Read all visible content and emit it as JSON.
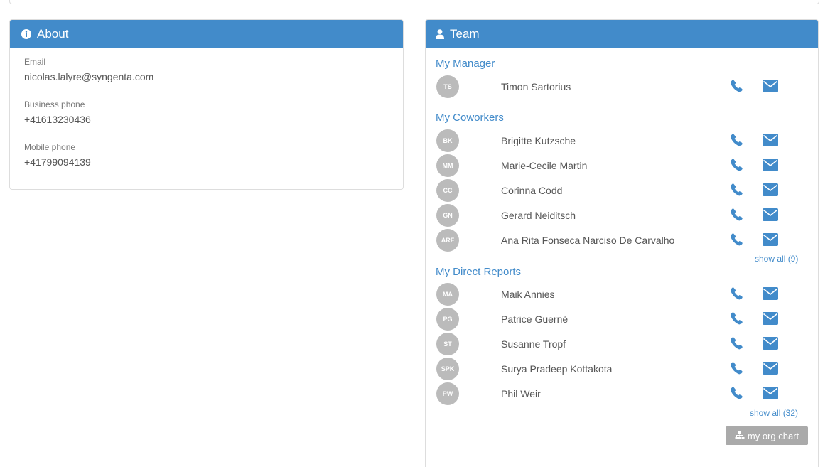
{
  "about": {
    "title": "About",
    "title_icon": "info-circle-icon",
    "fields": [
      {
        "label": "Email",
        "value": "nicolas.lalyre@syngenta.com"
      },
      {
        "label": "Business phone",
        "value": "+41613230436"
      },
      {
        "label": "Mobile phone",
        "value": "+41799094139"
      }
    ]
  },
  "team": {
    "title": "Team",
    "title_icon": "user-icon",
    "manager_title": "My Manager",
    "manager": {
      "initials": "TS",
      "name": "Timon Sartorius"
    },
    "coworkers_title": "My Coworkers",
    "coworkers": [
      {
        "initials": "BK",
        "name": "Brigitte Kutzsche"
      },
      {
        "initials": "MM",
        "name": "Marie-Cecile Martin"
      },
      {
        "initials": "CC",
        "name": "Corinna Codd"
      },
      {
        "initials": "GN",
        "name": "Gerard Neiditsch"
      },
      {
        "initials": "ARF",
        "name": "Ana Rita Fonseca Narciso De Carvalho"
      }
    ],
    "coworkers_show_all": "show all (9)",
    "reports_title": "My Direct Reports",
    "reports": [
      {
        "initials": "MA",
        "name": "Maik Annies"
      },
      {
        "initials": "PG",
        "name": "Patrice Guerné"
      },
      {
        "initials": "ST",
        "name": "Susanne Tropf"
      },
      {
        "initials": "SPK",
        "name": "Surya Pradeep Kottakota"
      },
      {
        "initials": "PW",
        "name": "Phil Weir"
      }
    ],
    "reports_show_all": "show all (32)",
    "org_chart_label": "my org chart",
    "org_chart_icon": "sitemap-icon",
    "phone_icon": "phone-icon",
    "mail_icon": "envelope-icon"
  },
  "colors": {
    "header": "#428bca",
    "link": "#428bca",
    "avatar": "#bbbbbb",
    "org_button": "#aaaaaa"
  }
}
